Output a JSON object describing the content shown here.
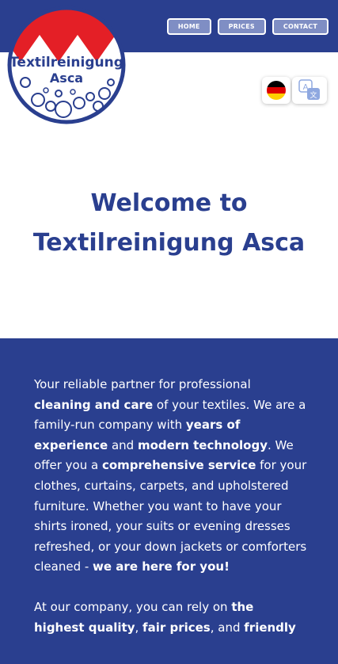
{
  "nav": {
    "home_label": "HOME",
    "prices_label": "PRICES",
    "contact_label": "CONTACT"
  },
  "logo": {
    "line1": "Textilreinigung",
    "line2": "Asca"
  },
  "hero": {
    "line1": "Welcome to",
    "line2": "Textilreinigung Asca"
  },
  "intro": {
    "s1": "Your reliable partner for professional ",
    "b1": "cleaning and care",
    "s2": " of your textiles. We are a family-run company with ",
    "b2": "years of experience",
    "s3": " and ",
    "b3": "modern technology",
    "s4": ". We offer you a ",
    "b4": "comprehensive service",
    "s5": " for your clothes, curtains, carpets, and upholstered furniture. Whether you want to have your shirts ironed, your suits or evening dresses refreshed, or your down jackets or comforters cleaned - ",
    "b5": "we are here for you!"
  },
  "second": {
    "s1": "At our company, you can rely on ",
    "b1": "the highest quality",
    "s2": ", ",
    "b2": "fair prices",
    "s3": ", and ",
    "b3": "friendly"
  },
  "colors": {
    "primary": "#2a3f8f",
    "nav_button_bg": "#7f8ec4",
    "logo_red": "#e41f26",
    "flag_black": "#000000",
    "flag_red": "#dd0000",
    "flag_gold": "#ffce00",
    "translate_blue": "#8fa8e0"
  },
  "icons": {
    "flag": "german-flag-icon",
    "translate": "translate-icon"
  }
}
